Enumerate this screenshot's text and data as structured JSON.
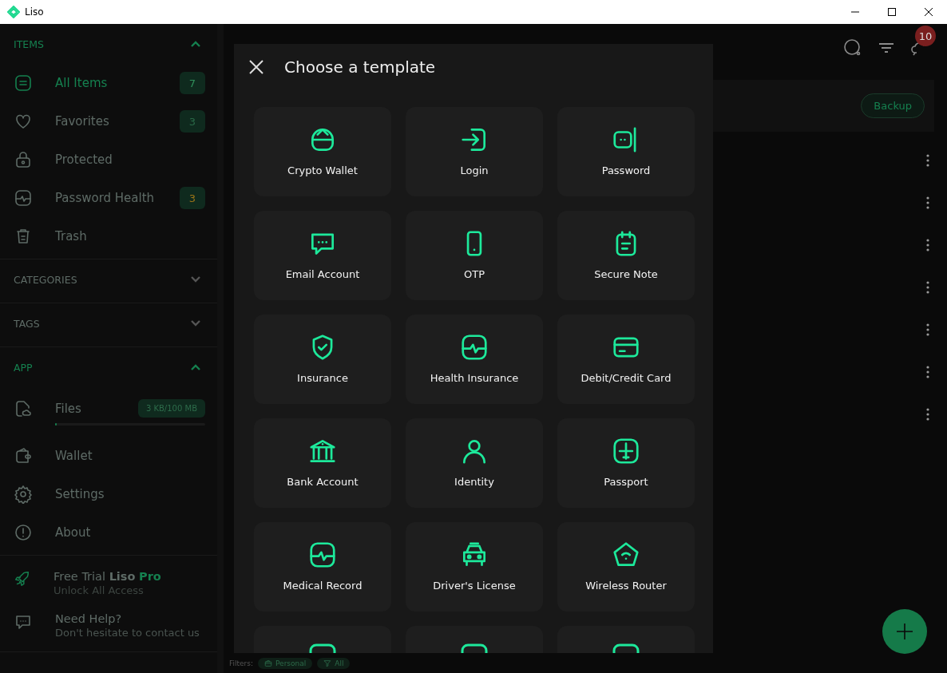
{
  "window": {
    "title": "Liso"
  },
  "sidebar": {
    "sections": [
      {
        "title": "ITEMS",
        "expanded": true,
        "items": [
          {
            "label": "All Items",
            "kind": "list",
            "selected": true,
            "count": "7",
            "color": "#2f8f5a"
          },
          {
            "label": "Favorites",
            "kind": "heart",
            "selected": false,
            "count": "3",
            "color": "#2a6a48"
          },
          {
            "label": "Protected",
            "kind": "lock",
            "selected": false
          },
          {
            "label": "Password Health",
            "kind": "pulse",
            "selected": false,
            "count": "3",
            "color": "#9a7418"
          },
          {
            "label": "Trash",
            "kind": "trash",
            "selected": false
          }
        ]
      },
      {
        "title": "CATEGORIES",
        "expanded": false
      },
      {
        "title": "TAGS",
        "expanded": false
      },
      {
        "title": "APP",
        "expanded": true,
        "items": [
          {
            "label": "Files",
            "kind": "file",
            "selected": false,
            "usage": "3 KB/100 MB",
            "level": 0.01
          },
          {
            "label": "Wallet",
            "kind": "wallet",
            "selected": false
          },
          {
            "label": "Settings",
            "kind": "gear",
            "selected": false
          },
          {
            "label": "About",
            "kind": "info",
            "selected": false
          }
        ]
      }
    ],
    "promo": {
      "parts": [
        {
          "text": "Free Trial ",
          "kind": "plain"
        },
        {
          "text": "Liso",
          "kind": "bold"
        },
        {
          "text": "Pro",
          "kind": "accent"
        }
      ],
      "subtitle": "Unlock All Access"
    },
    "help": {
      "title": "Need Help?",
      "subtitle": "Don't hesitate to contact us"
    }
  },
  "main": {
    "notification_count": "10",
    "backup_button": "Backup",
    "rows": [
      {
        "kind": "item"
      },
      {
        "kind": "item"
      },
      {
        "kind": "item"
      },
      {
        "kind": "item"
      },
      {
        "kind": "item"
      },
      {
        "kind": "item"
      },
      {
        "kind": "item"
      }
    ],
    "filters": {
      "label": "Filters:",
      "chips": [
        {
          "label": "Personal",
          "kind": "briefcase"
        },
        {
          "label": "All",
          "kind": "funnel"
        }
      ]
    }
  },
  "dialog": {
    "title": "Choose a template",
    "templates": [
      {
        "label": "Crypto Wallet",
        "kind": "cryptowallet"
      },
      {
        "label": "Login",
        "kind": "login"
      },
      {
        "label": "Password",
        "kind": "password"
      },
      {
        "label": "Email Account",
        "kind": "chat"
      },
      {
        "label": "OTP",
        "kind": "phone"
      },
      {
        "label": "Secure Note",
        "kind": "note"
      },
      {
        "label": "Insurance",
        "kind": "shield"
      },
      {
        "label": "Health Insurance",
        "kind": "pulse"
      },
      {
        "label": "Debit/Credit Card",
        "kind": "card"
      },
      {
        "label": "Bank Account",
        "kind": "bank"
      },
      {
        "label": "Identity",
        "kind": "person"
      },
      {
        "label": "Passport",
        "kind": "passport"
      },
      {
        "label": "Medical Record",
        "kind": "pulse"
      },
      {
        "label": "Driver's License",
        "kind": "car"
      },
      {
        "label": "Wireless Router",
        "kind": "router"
      },
      {
        "kind": "partial"
      },
      {
        "kind": "partial"
      },
      {
        "kind": "partial"
      }
    ]
  }
}
